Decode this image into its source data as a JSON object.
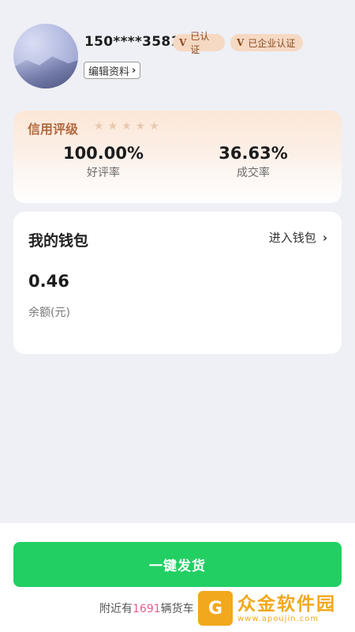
{
  "profile": {
    "phone": "150****3581",
    "badges": [
      "已认证",
      "已企业认证"
    ],
    "badge_mark": "V",
    "edit_label": "编辑资料",
    "edit_chevron": "›"
  },
  "credit": {
    "title": "信用评级",
    "stars": 5,
    "metrics": [
      {
        "value": "100.00%",
        "label": "好评率"
      },
      {
        "value": "36.63%",
        "label": "成交率"
      }
    ]
  },
  "wallet": {
    "title": "我的钱包",
    "enter_label": "进入钱包",
    "enter_chevron": "›",
    "balance": "0.46",
    "balance_label": "余额(元)"
  },
  "bottom": {
    "ship_label": "一键发货",
    "nearby_prefix": "附近有",
    "nearby_count": "1691",
    "nearby_suffix": "辆货车"
  },
  "watermark": {
    "logo_char": "G",
    "name": "众金软件园",
    "url": "www.apoujin.com"
  },
  "colors": {
    "accent_green": "#22cf63",
    "badge_bg": "#f6d9c3",
    "credit_title": "#b26a3e",
    "nearby_number": "#e85d8a"
  }
}
